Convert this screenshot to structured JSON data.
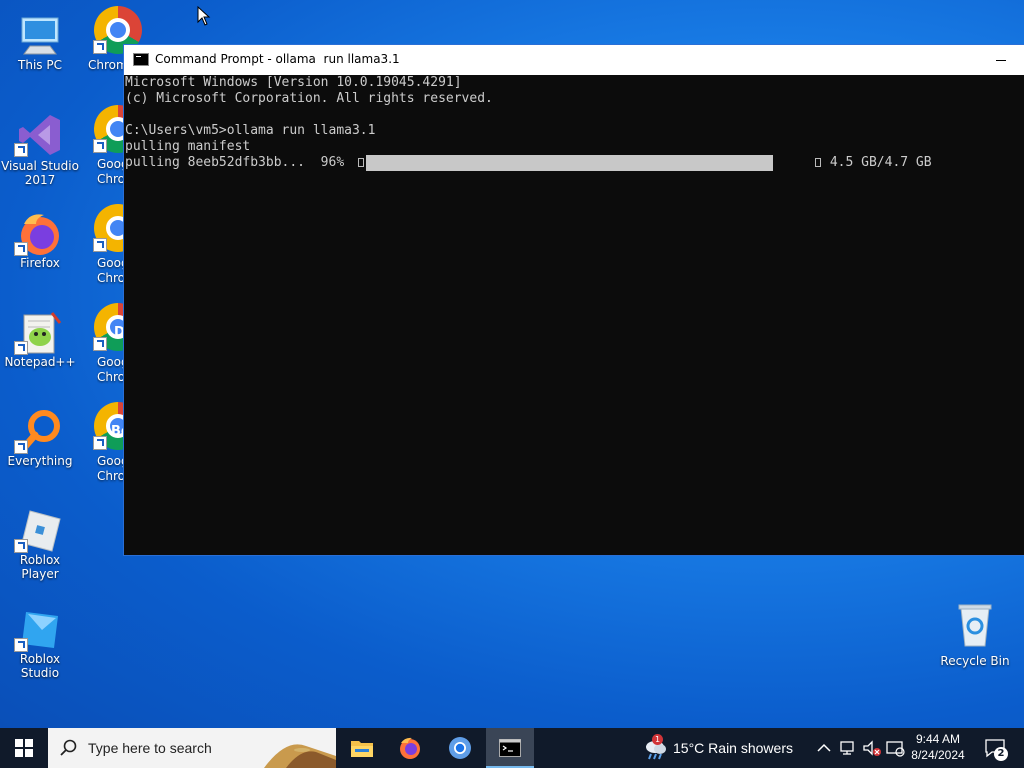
{
  "desktop": {
    "icons": [
      {
        "label_line1": "This PC",
        "label_line2": ""
      },
      {
        "label_line1": "Visual Studio",
        "label_line2": "2017"
      },
      {
        "label_line1": "Firefox",
        "label_line2": ""
      },
      {
        "label_line1": "Notepad++",
        "label_line2": ""
      },
      {
        "label_line1": "Everything",
        "label_line2": ""
      },
      {
        "label_line1": "Roblox Player",
        "label_line2": ""
      },
      {
        "label_line1": "Roblox Studio",
        "label_line2": ""
      }
    ],
    "chrome_column": [
      {
        "line1": "Chrom",
        "line2": ""
      },
      {
        "line1": "Goog",
        "line2": "Chron"
      },
      {
        "line1": "Goog",
        "line2": "Chro"
      },
      {
        "line1": "Goog",
        "line2": "Chrome"
      },
      {
        "line1": "Goog",
        "line2": "Chrome"
      }
    ],
    "chrome_badges": [
      "D",
      "Be"
    ],
    "recycle_bin_label": "Recycle Bin"
  },
  "cmd_window": {
    "title": "Command Prompt - ollama  run llama3.1",
    "lines": [
      "Microsoft Windows [Version 10.0.19045.4291]",
      "(c) Microsoft Corporation. All rights reserved.",
      "",
      "C:\\Users\\vm5>ollama run llama3.1",
      "pulling manifest"
    ],
    "pull_prefix": "pulling 8eeb52dfb3bb...  96% ",
    "pull_size": " 4.5 GB/4.7 GB",
    "progress_fraction": 0.96
  },
  "taskbar": {
    "search_placeholder": "Type here to search",
    "weather": "15°C  Rain showers",
    "weather_badge": "1",
    "time": "9:44 AM",
    "date": "8/24/2024",
    "notification_count": "2"
  },
  "colors": {
    "console_bg": "#0c0c0c",
    "console_fg": "#cccccc",
    "taskbar_bg": "#101a2a",
    "accent": "#76b9ed"
  },
  "icons": {
    "start": "windows-logo-icon",
    "search": "search-icon",
    "explorer": "file-explorer-icon",
    "firefox": "firefox-icon",
    "chrome": "chrome-icon",
    "terminal": "command-prompt-icon",
    "recycle": "recycle-bin-icon"
  }
}
